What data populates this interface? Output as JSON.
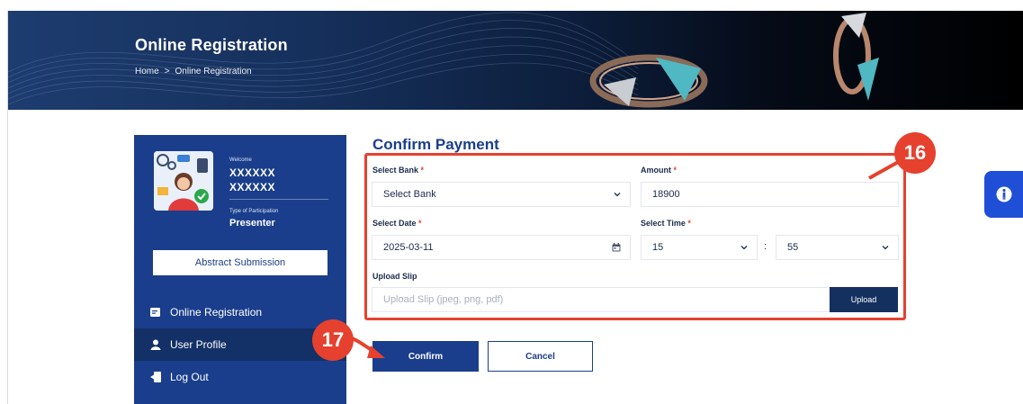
{
  "banner": {
    "title": "Online Registration",
    "breadcrumb": {
      "home": "Home",
      "separator": ">",
      "current": "Online Registration"
    }
  },
  "sidebar": {
    "welcome_label": "Welcome",
    "first_name": "XXXXXX",
    "last_name": "XXXXXX",
    "participation_label": "Type of Participation",
    "participation_type": "Presenter",
    "abstract_button": "Abstract Submission",
    "nav": [
      {
        "label": "Online Registration",
        "icon": "registration-icon"
      },
      {
        "label": "User Profile",
        "icon": "user-icon",
        "active": true
      },
      {
        "label": "Log Out",
        "icon": "logout-icon"
      }
    ]
  },
  "form": {
    "title": "Confirm Payment",
    "bank": {
      "label": "Select Bank",
      "required": "*",
      "value": "Select Bank"
    },
    "amount": {
      "label": "Amount",
      "required": "*",
      "value": "18900"
    },
    "date": {
      "label": "Select Date",
      "required": "*",
      "value": "2025-03-11"
    },
    "time": {
      "label": "Select Time",
      "required": "*",
      "hour": "15",
      "separator": ":",
      "minute": "55"
    },
    "slip": {
      "label": "Upload Slip",
      "placeholder": "Upload Slip (jpeg, png, pdf)",
      "button": "Upload"
    },
    "confirm_button": "Confirm",
    "cancel_button": "Cancel"
  },
  "annotations": {
    "badge_form": "16",
    "badge_confirm": "17"
  },
  "colors": {
    "primary": "#1a3e8b",
    "dark_button": "#14305f",
    "annotation_red": "#e6412e",
    "accessibility_blue": "#1f4fd6"
  }
}
